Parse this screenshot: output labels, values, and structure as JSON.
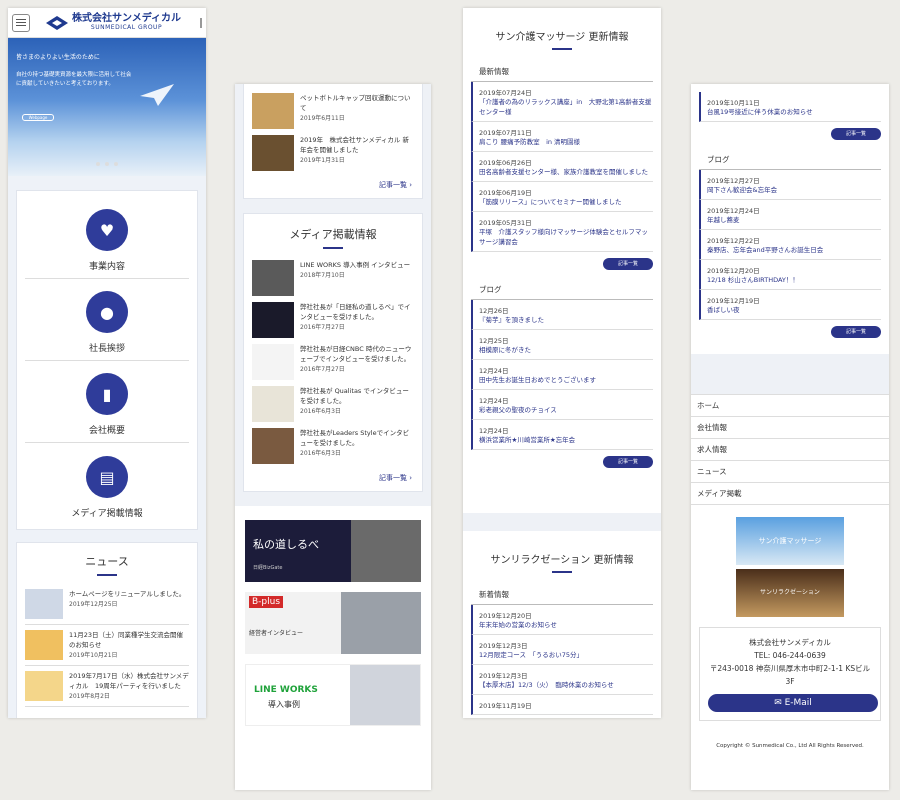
{
  "header": {
    "company_name": "株式会社サンメディカル",
    "company_sub": "SUNMEDICAL GROUP"
  },
  "hero": {
    "line1": "皆さまのよりよい生活のために",
    "line2": "自社の持つ基礎実資源を最大限に活用して社会に貢献していきたいと考えております。",
    "button": "Webpage"
  },
  "menu": [
    {
      "label": "事業内容",
      "icon": "heart-hand-icon"
    },
    {
      "label": "社長挨拶",
      "icon": "person-icon"
    },
    {
      "label": "会社概要",
      "icon": "building-icon"
    },
    {
      "label": "メディア掲載情報",
      "icon": "newspaper-icon"
    }
  ],
  "news": {
    "title": "ニュース",
    "items": [
      {
        "text": "ホームページをリニューアルしました。",
        "date": "2019年12月25日"
      },
      {
        "text": "11月23日（土）同業種学生交流会開催のお知らせ",
        "date": "2019年10月21日"
      },
      {
        "text": "2019年7月17日（水）株式会社サンメディカル　19周年パーティを行いました",
        "date": "2019年8月2日"
      }
    ]
  },
  "news2": [
    {
      "text": "ペットボトルキャップ回収運動について",
      "date": "2019年6月11日"
    },
    {
      "text": "2019年　株式会社サンメディカル 新年会を開催しました",
      "date": "2019年1月31日"
    }
  ],
  "more_label": "記事一覧 ›",
  "media": {
    "title": "メディア掲載情報",
    "items": [
      {
        "text": "LINE WORKS 導入事例 インタビュー",
        "date": "2018年7月10日"
      },
      {
        "text": "弊社社長が「日経私の道しるべ」でインタビューを受けました。",
        "date": "2016年7月27日"
      },
      {
        "text": "弊社社長が日経CNBC 時代のニューウェーブでインタビューを受けました。",
        "date": "2016年7月27日"
      },
      {
        "text": "弊社社長が Qualitas でインタビューを受けました。",
        "date": "2016年6月3日"
      },
      {
        "text": "弊社社長がLeaders Styleでインタビューを受けました。",
        "date": "2016年6月3日"
      }
    ]
  },
  "banners": [
    {
      "text": "私の道しるべ",
      "sub": "日経BizGate"
    },
    {
      "text": "B-plus",
      "sub": "経営者インタビュー"
    },
    {
      "text": "LINE WORKS",
      "sub": "導入事例"
    }
  ],
  "kaigo": {
    "title": "サン介護マッサージ 更新情報",
    "sub1": "最新情報",
    "items1": [
      {
        "d": "2019年07月24日",
        "t": "「介護者の為のリラックス講座」in　大野北第1高齢者支援センター様"
      },
      {
        "d": "2019年07月11日",
        "t": "肩こり 腰痛予防教室　in 清明園様"
      },
      {
        "d": "2019年06月26日",
        "t": "田名高齢者支援センター様、家族介護教室を開催しました"
      },
      {
        "d": "2019年06月19日",
        "t": "「筋膜リリース」についてセミナー開催しました"
      },
      {
        "d": "2019年05月31日",
        "t": "平塚　介護スタッフ様向けマッサージ体験会とセルフマッサージ講習会"
      }
    ],
    "sub2": "ブログ",
    "items2": [
      {
        "d": "12月26日",
        "t": "『菊芋』を頂きました"
      },
      {
        "d": "12月25日",
        "t": "相模原に冬がきた"
      },
      {
        "d": "12月24日",
        "t": "田中先生お誕生日おめでとうございます"
      },
      {
        "d": "12月24日",
        "t": "彩老親父の聖夜のチョイス"
      },
      {
        "d": "12月24日",
        "t": "横浜営業所★川崎営業所★忘年会"
      }
    ]
  },
  "btn_label": "記事一覧",
  "relax": {
    "title": "サンリラクゼーション 更新情報",
    "sub1": "新着情報",
    "items1": [
      {
        "d": "2019年12月20日",
        "t": "年末年始の営業のお知らせ"
      },
      {
        "d": "2019年12月3日",
        "t": "12月限定コース　「うるおい75分」"
      },
      {
        "d": "2019年12月3日",
        "t": "【本厚木店】12/3（火）　臨時休業のお知らせ"
      },
      {
        "d": "2019年11月19日",
        "t": ""
      }
    ]
  },
  "strip4": {
    "items1": [
      {
        "d": "2019年10月11日",
        "t": "台風19号接近に伴う休業のお知らせ"
      }
    ],
    "sub2": "ブログ",
    "items2": [
      {
        "d": "2019年12月27日",
        "t": "岡下さん歓迎会&忘年会"
      },
      {
        "d": "2019年12月24日",
        "t": "年越し蕎麦"
      },
      {
        "d": "2019年12月22日",
        "t": "秦野店、忘年会and平野さんお誕生日会"
      },
      {
        "d": "2019年12月20日",
        "t": "12/18 杉山さんBIRTHDAY！！"
      },
      {
        "d": "2019年12月19日",
        "t": "香ばしい夜"
      }
    ]
  },
  "footer_nav": [
    "ホーム",
    "会社情報",
    "求人情報",
    "ニュース",
    "メディア掲載"
  ],
  "footer_banners": [
    "サン介護マッサージ",
    "サンリラクゼーション"
  ],
  "company": {
    "name": "株式会社サンメディカル",
    "tel": "TEL: 046-244-0639",
    "address": "〒243-0018 神奈川県厚木市中町2-1-1 KSビル3F",
    "email": "✉ E-Mail"
  },
  "copyright": "Copyright © Sunmedical Co., Ltd  All Rights Reserved.",
  "colors": {
    "brand": "#2b3489"
  }
}
